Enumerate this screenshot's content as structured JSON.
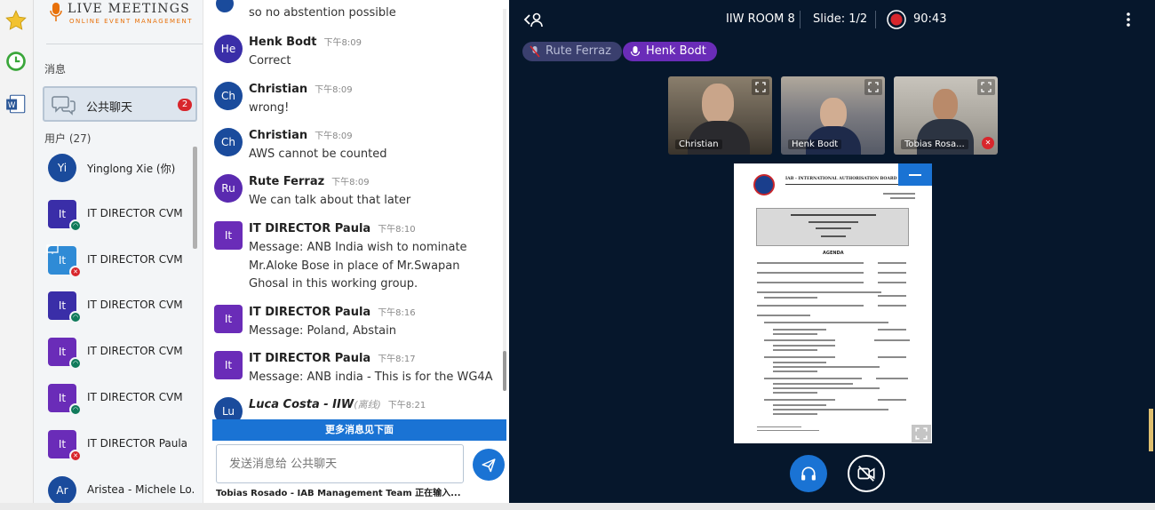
{
  "brand": {
    "name": "LIVE MEETINGS",
    "tagline": "ONLINE EVENT MANAGEMENT"
  },
  "sidebar": {
    "messages_header": "消息",
    "public_chat": {
      "label": "公共聊天",
      "unread": "2"
    },
    "users_header": "用户 (27)",
    "users": [
      {
        "initials": "Yi",
        "name": "Yinglong Xie (你)",
        "color": "#1a4b9c",
        "shape": "round",
        "status": "none"
      },
      {
        "initials": "It",
        "name": "IT DIRECTOR CVM",
        "color": "#3a2ea8",
        "shape": "sq",
        "status": "on"
      },
      {
        "initials": "It",
        "name": "IT DIRECTOR CVM",
        "color": "#2f8bd6",
        "shape": "sq",
        "status": "off"
      },
      {
        "initials": "It",
        "name": "IT DIRECTOR CVM",
        "color": "#3a2ea8",
        "shape": "sq",
        "status": "on"
      },
      {
        "initials": "It",
        "name": "IT DIRECTOR CVM",
        "color": "#6a2cb8",
        "shape": "sq",
        "status": "on"
      },
      {
        "initials": "It",
        "name": "IT DIRECTOR CVM",
        "color": "#6a2cb8",
        "shape": "sq",
        "status": "on"
      },
      {
        "initials": "It",
        "name": "IT DIRECTOR Paula",
        "color": "#6a2cb8",
        "shape": "sq",
        "status": "off"
      },
      {
        "initials": "Ar",
        "name": "Aristea - Michele Lo...",
        "color": "#1a4b9c",
        "shape": "round",
        "status": "none"
      }
    ]
  },
  "chat": {
    "top_fragment": "so no abstention possible",
    "messages": [
      {
        "initials": "He",
        "sender": "Henk Bodt",
        "time": "下午8:09",
        "text": "Correct",
        "color": "#3a2ea8",
        "shape": "round"
      },
      {
        "initials": "Ch",
        "sender": "Christian",
        "time": "下午8:09",
        "text": "wrong!",
        "color": "#1a4b9c",
        "shape": "round"
      },
      {
        "initials": "Ch",
        "sender": "Christian",
        "time": "下午8:09",
        "text": "AWS cannot be counted",
        "color": "#1a4b9c",
        "shape": "round"
      },
      {
        "initials": "Ru",
        "sender": "Rute Ferraz",
        "time": "下午8:09",
        "text": "We can talk about that later",
        "color": "#5a2ab0",
        "shape": "round"
      },
      {
        "initials": "It",
        "sender": "IT DIRECTOR Paula",
        "time": "下午8:10",
        "text": "Message: ANB India wish to nominate Mr.Aloke Bose in place of Mr.Swapan Ghosal in this working group.",
        "color": "#6a2cb8",
        "shape": "sq"
      },
      {
        "initials": "It",
        "sender": "IT DIRECTOR Paula",
        "time": "下午8:16",
        "text": "Message: Poland, Abstain",
        "color": "#6a2cb8",
        "shape": "sq"
      },
      {
        "initials": "It",
        "sender": "IT DIRECTOR Paula",
        "time": "下午8:17",
        "text": "Message: ANB india - This is for the WG4A",
        "color": "#6a2cb8",
        "shape": "sq"
      },
      {
        "initials": "Lu",
        "sender": "Luca Costa - IIW",
        "sender_suffix": "(离线)",
        "time": "下午8:21",
        "text": "",
        "color": "#1a4b9c",
        "shape": "round"
      }
    ],
    "more_messages": "更多消息见下面",
    "input_placeholder": "发送消息给 公共聊天",
    "typing": "Tobias Rosado - IAB Management Team 正在输入..."
  },
  "stage": {
    "room": "IIW ROOM 8",
    "slide": "Slide: 1/2",
    "timer": "90:43",
    "talkers": [
      {
        "name": "Rute Ferraz",
        "muted": true
      },
      {
        "name": "Henk Bodt",
        "muted": false
      }
    ],
    "videos": [
      {
        "name": "Christian",
        "bg": "#6f6456"
      },
      {
        "name": "Henk Bodt",
        "bg": "#8a8f99"
      },
      {
        "name": "Tobias Rosa...",
        "bg": "#a6a29a"
      }
    ],
    "slide_content": {
      "title": "IAB - INTERNATIONAL AUTHORISATION BOARD",
      "agenda": "AGENDA"
    }
  },
  "colors": {
    "accent": "#1a73d4",
    "stage_bg": "#06172c",
    "record": "#d8262c"
  }
}
